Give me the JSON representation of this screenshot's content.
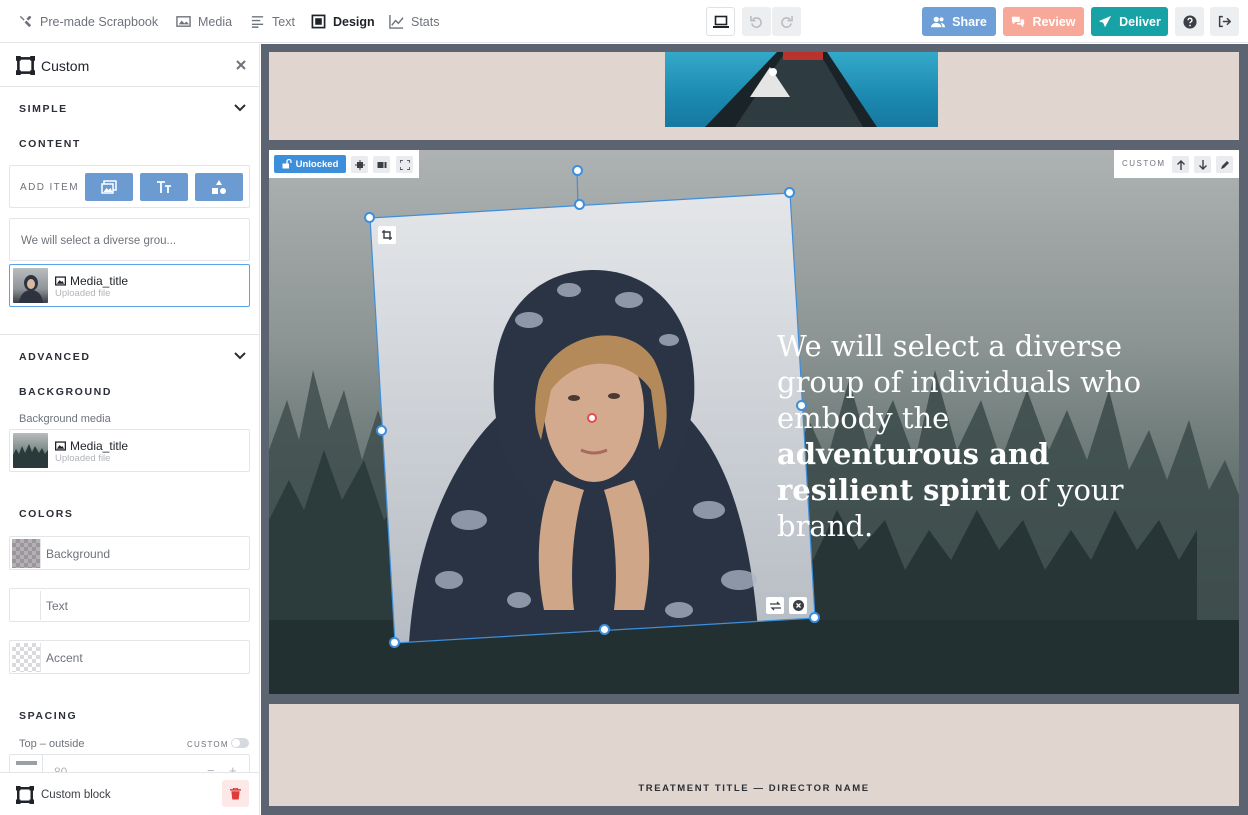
{
  "toolbar": {
    "nav": [
      {
        "label": "Pre-made Scrapbook",
        "icon": "tools-icon"
      },
      {
        "label": "Media",
        "icon": "image-icon"
      },
      {
        "label": "Text",
        "icon": "text-lines-icon"
      },
      {
        "label": "Design",
        "icon": "design-icon"
      },
      {
        "label": "Stats",
        "icon": "chart-icon"
      }
    ],
    "share_label": "Share",
    "review_label": "Review",
    "deliver_label": "Deliver"
  },
  "sidebar": {
    "title": "Custom",
    "simple": {
      "title": "SIMPLE",
      "content_title": "CONTENT",
      "add_item_label": "ADD ITEM",
      "text_item": "We will select a diverse grou...",
      "media_item": {
        "name": "Media_title",
        "sub": "Uploaded file"
      }
    },
    "advanced": {
      "title": "ADVANCED",
      "background_title": "BACKGROUND",
      "background_media_label": "Background media",
      "background_item": {
        "name": "Media_title",
        "sub": "Uploaded file"
      },
      "colors_title": "COLORS",
      "colors": [
        {
          "label": "Background"
        },
        {
          "label": "Text"
        },
        {
          "label": "Accent"
        }
      ],
      "spacing_title": "SPACING",
      "top_outside_label": "Top – outside",
      "custom_label": "CUSTOM",
      "spacing_value": "80",
      "minus": "−",
      "plus": "+"
    },
    "footer_label": "Custom block"
  },
  "canvas": {
    "lock_label": "Unlocked",
    "block_label": "CUSTOM",
    "headline": {
      "part1": "We will select a diverse group of individuals who embody the ",
      "bold": "adventurous and resilient spirit",
      "part2": " of your brand."
    },
    "footer_text": "TREATMENT TITLE — DIRECTOR NAME"
  },
  "colors": {
    "share": "#6e9fd6",
    "review": "#f7a898",
    "deliver": "#17a2a5",
    "unlocked": "#3d8fdc",
    "selection": "#3d8fdc"
  }
}
